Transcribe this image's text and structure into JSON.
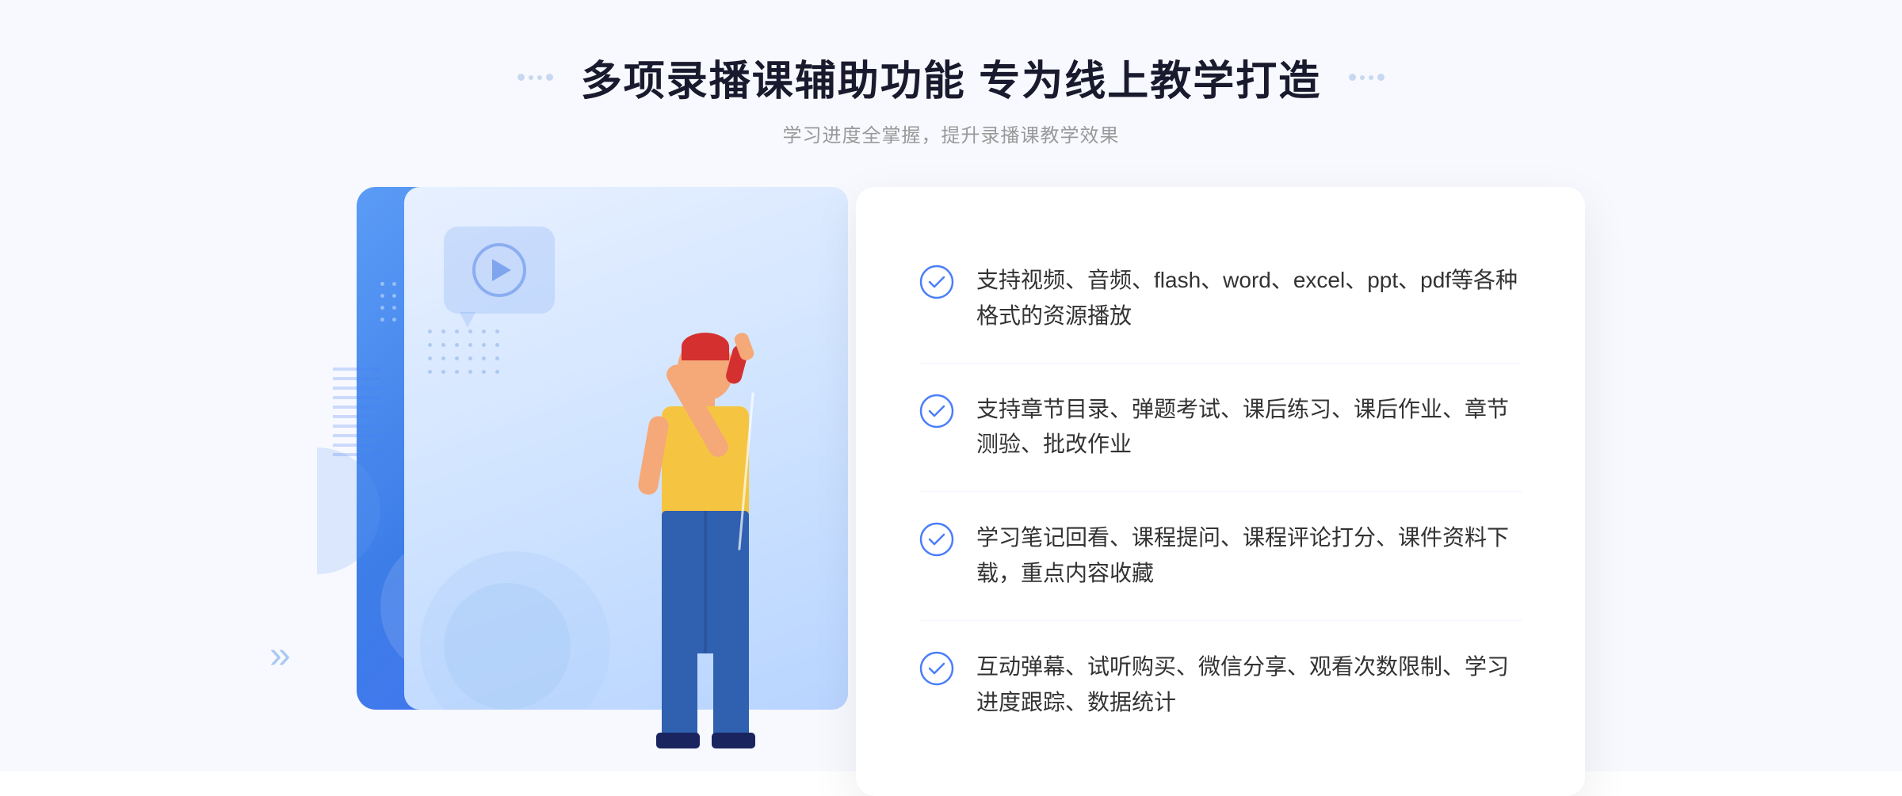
{
  "page": {
    "background_color": "#f0f5ff"
  },
  "header": {
    "title": "多项录播课辅助功能 专为线上教学打造",
    "subtitle": "学习进度全掌握，提升录播课教学效果"
  },
  "features": [
    {
      "id": 1,
      "text": "支持视频、音频、flash、word、excel、ppt、pdf等各种格式的资源播放"
    },
    {
      "id": 2,
      "text": "支持章节目录、弹题考试、课后练习、课后作业、章节测验、批改作业"
    },
    {
      "id": 3,
      "text": "学习笔记回看、课程提问、课程评论打分、课件资料下载，重点内容收藏"
    },
    {
      "id": 4,
      "text": "互动弹幕、试听购买、微信分享、观看次数限制、学习进度跟踪、数据统计"
    }
  ],
  "icons": {
    "check_color": "#4a7efa",
    "play_color": "rgba(255,255,255,0.9)"
  }
}
